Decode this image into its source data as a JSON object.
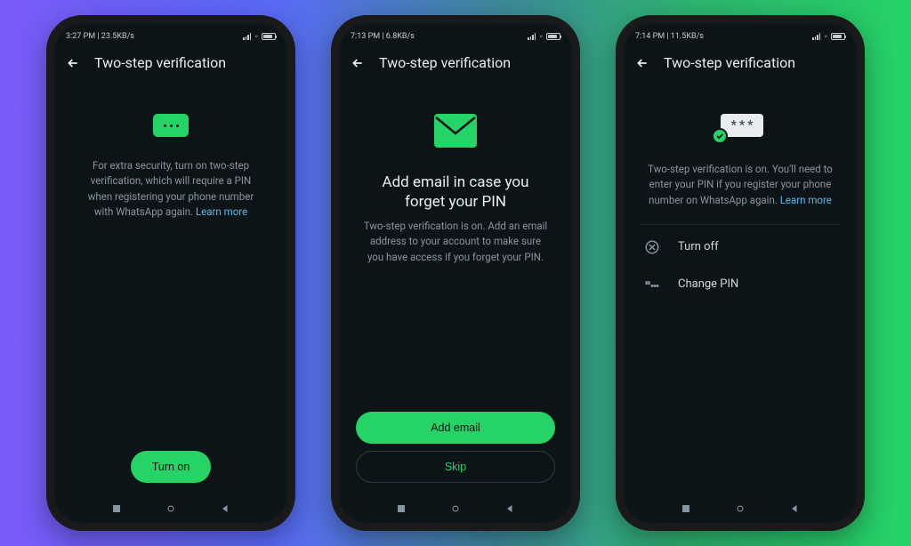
{
  "phones": [
    {
      "status": {
        "time": "3:27 PM",
        "net": "23.5KB/s"
      },
      "title": "Two-step verification",
      "desc": "For extra security, turn on two-step verification, which will require a PIN when registering your phone number with WhatsApp again.",
      "learn_more": "Learn more",
      "primary_btn": "Turn on"
    },
    {
      "status": {
        "time": "7:13 PM",
        "net": "6.8KB/s"
      },
      "title": "Two-step verification",
      "heading": "Add email in case you forget your PIN",
      "desc": "Two-step verification is on. Add an email address to your account to make sure you have access if you forget your PIN.",
      "primary_btn": "Add email",
      "secondary_btn": "Skip"
    },
    {
      "status": {
        "time": "7:14 PM",
        "net": "11.5KB/s"
      },
      "title": "Two-step verification",
      "desc": "Two-step verification is on. You'll need to enter your PIN if you register your phone number on WhatsApp again.",
      "learn_more": "Learn more",
      "items": [
        {
          "label": "Turn off"
        },
        {
          "label": "Change PIN"
        }
      ]
    }
  ]
}
